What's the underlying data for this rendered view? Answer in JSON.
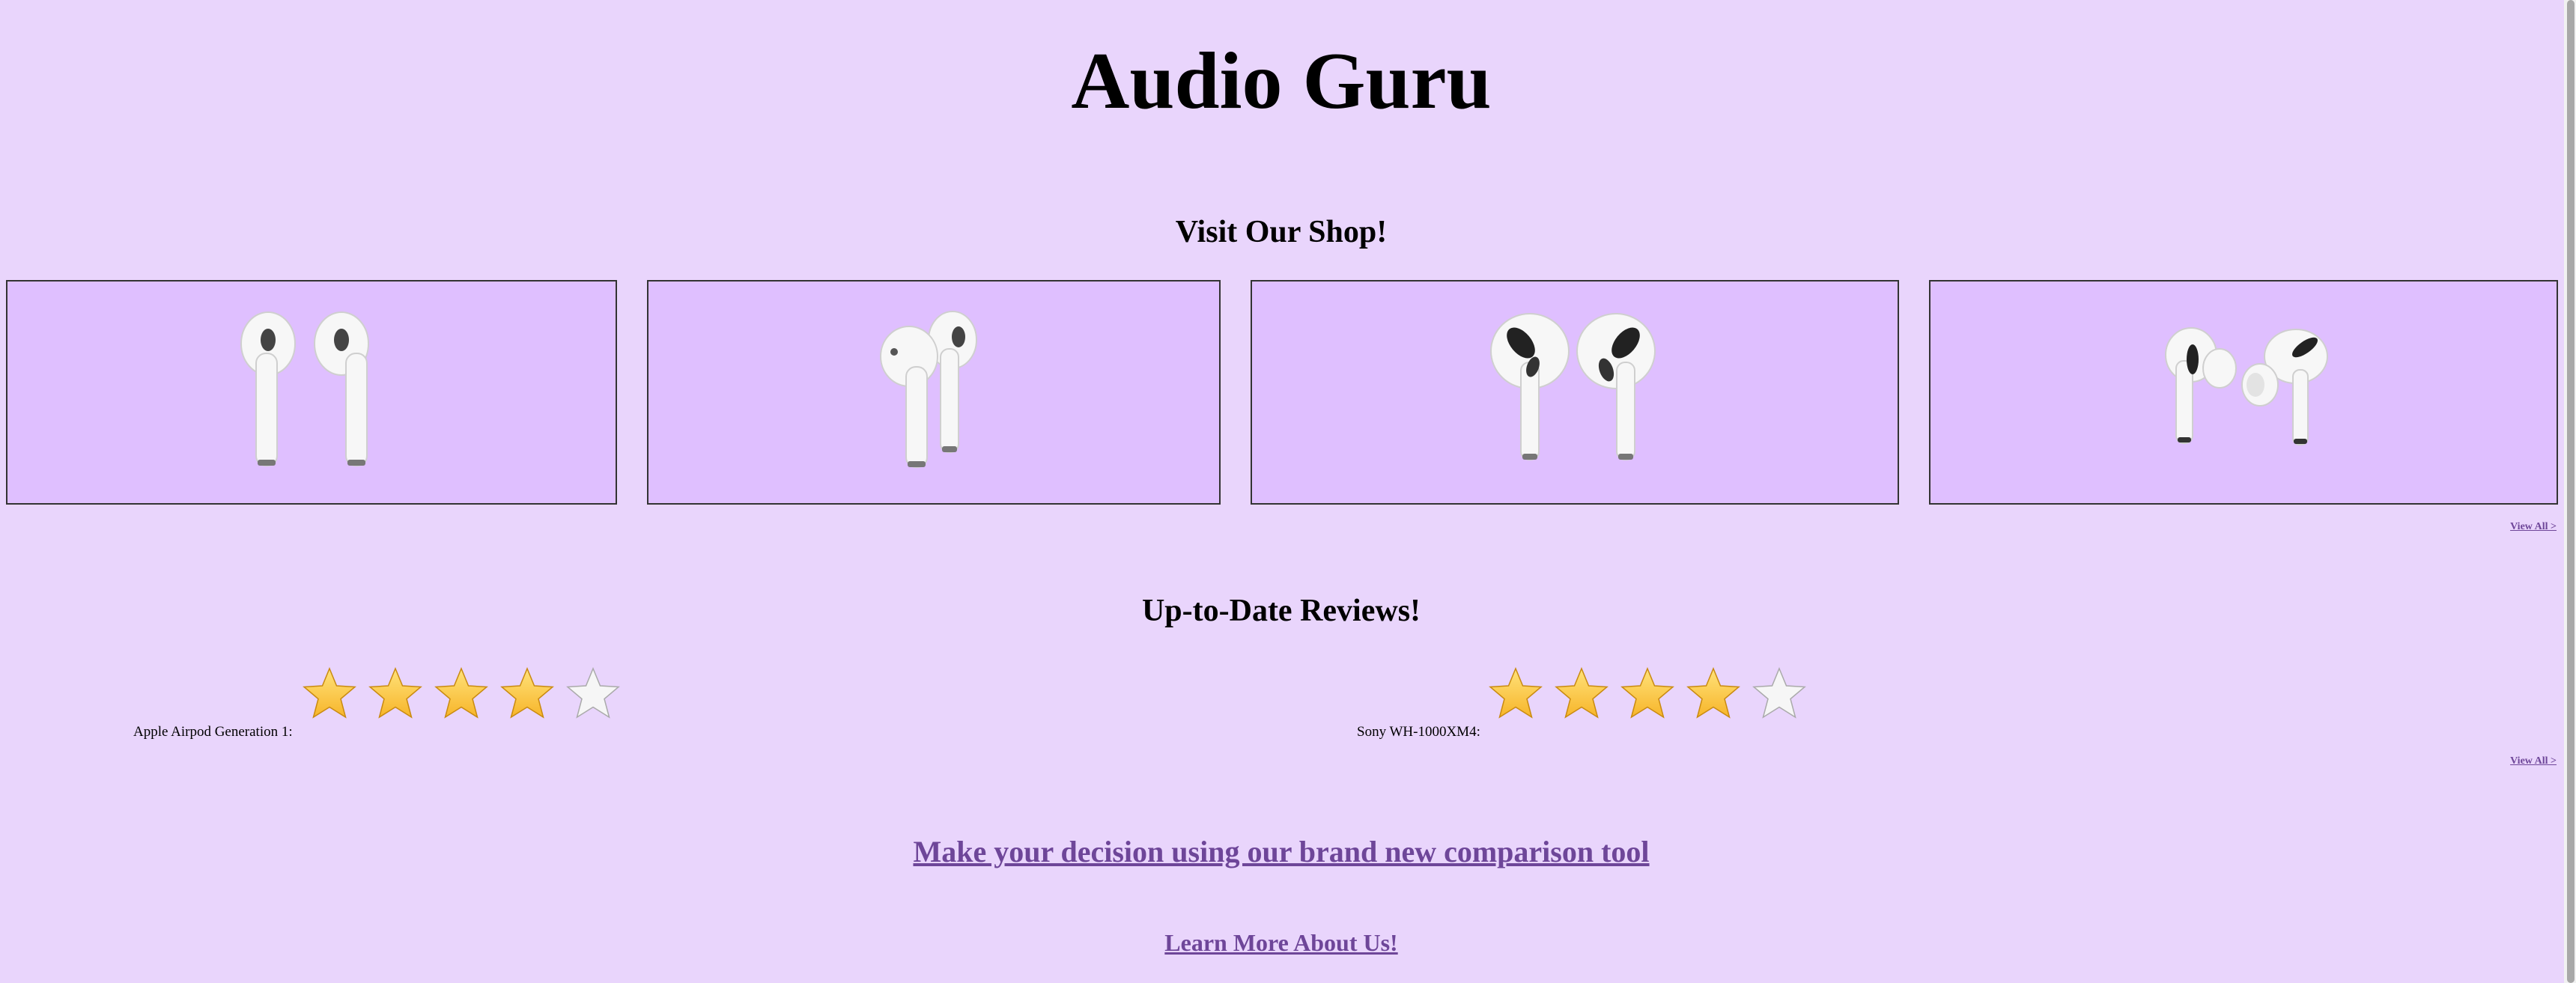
{
  "site": {
    "title": "Audio Guru"
  },
  "shop": {
    "heading": "Visit Our Shop!",
    "view_all": "View All >",
    "products": [
      {
        "icon": "airpods-front-icon"
      },
      {
        "icon": "airpods-side-icon"
      },
      {
        "icon": "airpods-gen3-icon"
      },
      {
        "icon": "airpods-pro-icon"
      }
    ]
  },
  "reviews": {
    "heading": "Up-to-Date Reviews!",
    "view_all": "View All >",
    "items": [
      {
        "label": "Apple Airpod Generation 1:",
        "rating": 4,
        "max": 5
      },
      {
        "label": "Sony WH-1000XM4:",
        "rating": 4,
        "max": 5
      }
    ]
  },
  "links": {
    "compare": "Make your decision using our brand new comparison tool",
    "about": "Learn More About Us!"
  },
  "colors": {
    "background": "#e9d5fc",
    "card": "#dfbfff",
    "link": "#6e4699",
    "star": "#f7b52a"
  }
}
